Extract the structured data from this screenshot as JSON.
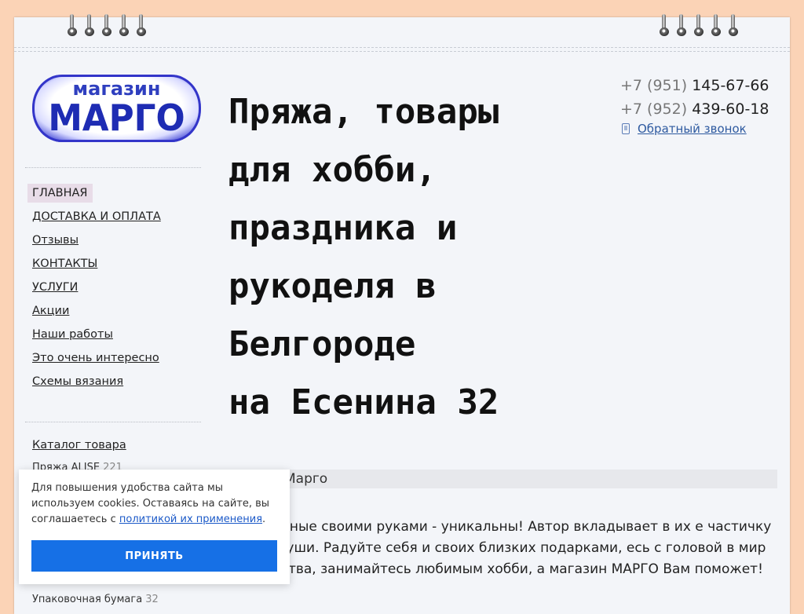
{
  "logo": {
    "small": "магазин",
    "big": "МАРГО"
  },
  "headline": {
    "lines": [
      "Пряжа, товары",
      "для хобби,",
      "праздника и",
      "рукоделя в",
      "Белгороде",
      "на Есенина 32"
    ]
  },
  "phones": [
    {
      "code": "+7 (951)",
      "number": "145-67-66"
    },
    {
      "code": "+7 (952)",
      "number": "439-60-18"
    }
  ],
  "callback": {
    "label": "Обратный звонок",
    "icon": "phone-icon"
  },
  "menu": {
    "items": [
      {
        "label": "ГЛАВНАЯ",
        "active": true
      },
      {
        "label": "ДОСТАВКА И ОПЛАТА"
      },
      {
        "label": "Отзывы"
      },
      {
        "label": "КОНТАКТЫ"
      },
      {
        "label": "УСЛУГИ"
      },
      {
        "label": "Акции"
      },
      {
        "label": "Наши работы"
      },
      {
        "label": "Это очень интересно"
      },
      {
        "label": "Схемы вязания"
      }
    ],
    "catalog": "Каталог товара",
    "sub_items": [
      {
        "label": "Пряжа ALISE",
        "count": "221"
      },
      {
        "label": "Упаковочная бумага",
        "count": "32"
      }
    ]
  },
  "content": {
    "bar_title": "Марго",
    "paragraph": ", созданные своими руками - уникальны! Автор вкладывает в их е частичку своей души. Радуйте себя и своих близких подарками, есь с головой в мир творчества, занимайтесь любимым хобби, а магазин МАРГО Вам поможет!"
  },
  "cookie": {
    "text": "Для повышения удобства сайта мы используем cookies. Оставаясь на сайте, вы соглашаетесь с",
    "link": "политикой их применения",
    "after_link": ".",
    "button": "ПРИНЯТЬ"
  },
  "colors": {
    "page_bg": "#fbd3b6",
    "sheet_bg": "#f3f5f9",
    "accent": "#1670e6",
    "logo_blue": "#2327b7",
    "active_menu_bg": "#e8dce8"
  }
}
